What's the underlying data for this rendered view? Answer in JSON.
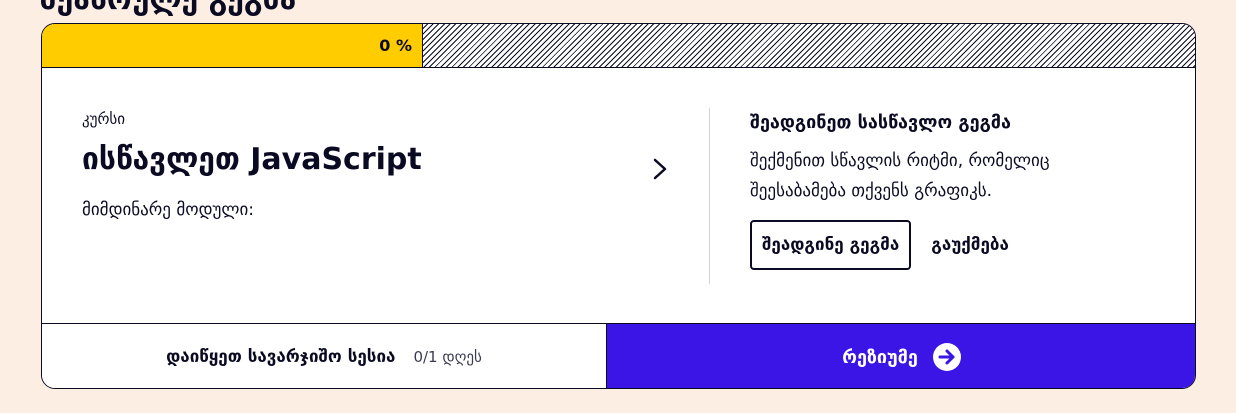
{
  "page": {
    "heading": "შეასრულე გეგმა"
  },
  "progress": {
    "label": "0 %",
    "value_percent": 0,
    "fill_color": "#ffcc00"
  },
  "course": {
    "kicker": "კურსი",
    "title": "ისწავლეთ JavaScript",
    "current_module_label": "მიმდინარე მოდული:",
    "open_icon": "chevron-right-icon"
  },
  "plan": {
    "title": "შეადგინეთ სასწავლო გეგმა",
    "description": "შექმენით სწავლის რიტმი, რომელიც შეესაბამება თქვენს გრაფიკს.",
    "create_button": "შეადგინე გეგმა",
    "dismiss_button": "გაუქმება"
  },
  "practice": {
    "label": "დაიწყეთ სავარჯიშო სესია",
    "count": "0/1 დღეს"
  },
  "resume": {
    "label": "რეზიუმე",
    "icon": "arrow-right-circle-icon",
    "background_color": "#3b14e6"
  }
}
